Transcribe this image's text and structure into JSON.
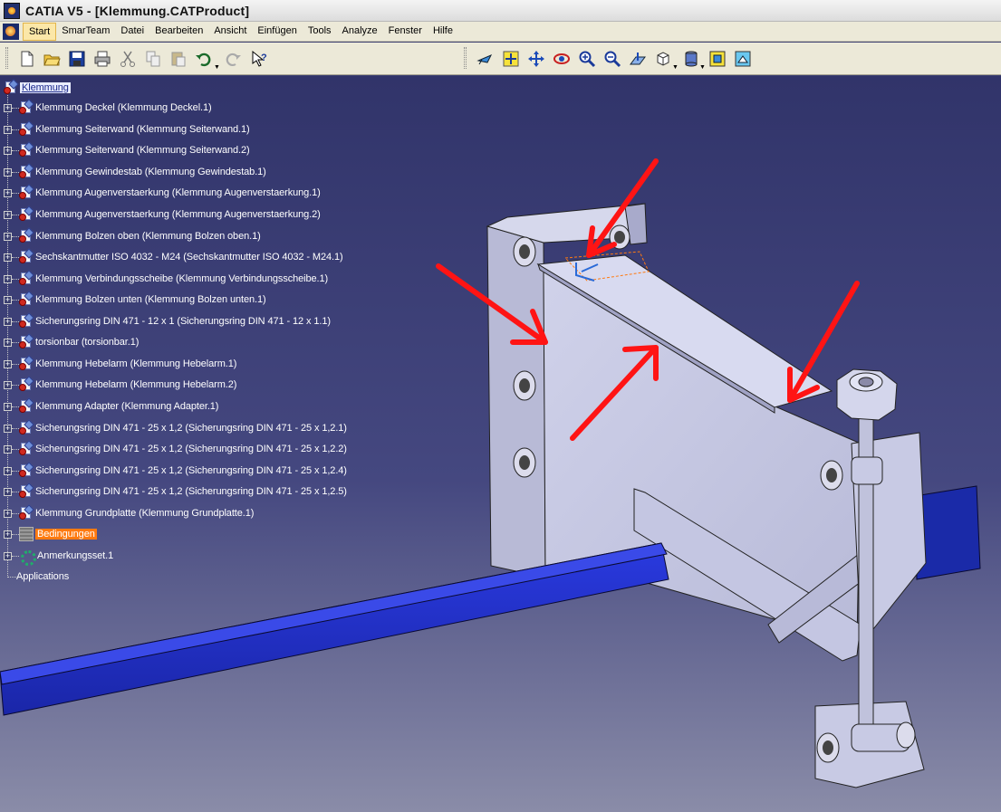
{
  "window": {
    "title": "CATIA V5 - [Klemmung.CATProduct]"
  },
  "menu": {
    "items": [
      "Start",
      "SmarTeam",
      "Datei",
      "Bearbeiten",
      "Ansicht",
      "Einfügen",
      "Tools",
      "Analyze",
      "Fenster",
      "Hilfe"
    ],
    "active": "Start"
  },
  "toolbar": {
    "left": [
      "new-icon",
      "open-icon",
      "save-icon",
      "print-icon",
      "cut-icon",
      "copy-icon",
      "paste-icon",
      "undo-icon",
      "redo-icon",
      "whats-this-icon"
    ],
    "right": [
      "fly-mode-icon",
      "fit-all-icon",
      "pan-icon",
      "rotate-icon",
      "zoom-in-icon",
      "zoom-out-icon",
      "normal-view-icon",
      "iso-view-icon",
      "render-style-icon",
      "hide-show-icon",
      "swap-space-icon"
    ]
  },
  "tree": {
    "root": "Klemmung",
    "nodes": [
      "Klemmung Deckel (Klemmung Deckel.1)",
      "Klemmung Seiterwand (Klemmung Seiterwand.1)",
      "Klemmung Seiterwand (Klemmung Seiterwand.2)",
      "Klemmung Gewindestab (Klemmung Gewindestab.1)",
      "Klemmung Augenverstaerkung (Klemmung Augenverstaerkung.1)",
      "Klemmung Augenverstaerkung (Klemmung Augenverstaerkung.2)",
      "Klemmung Bolzen oben (Klemmung Bolzen oben.1)",
      "Sechskantmutter ISO 4032 - M24 (Sechskantmutter ISO 4032 - M24.1)",
      "Klemmung Verbindungsscheibe (Klemmung Verbindungsscheibe.1)",
      "Klemmung Bolzen unten (Klemmung Bolzen unten.1)",
      "Sicherungsring DIN 471 - 12 x 1 (Sicherungsring DIN 471 - 12 x 1.1)",
      "torsionbar (torsionbar.1)",
      "Klemmung Hebelarm (Klemmung Hebelarm.1)",
      "Klemmung Hebelarm (Klemmung Hebelarm.2)",
      "Klemmung Adapter (Klemmung Adapter.1)",
      "Sicherungsring DIN 471 - 25 x 1,2 (Sicherungsring DIN 471 - 25 x 1,2.1)",
      "Sicherungsring DIN 471 - 25 x 1,2 (Sicherungsring DIN 471 - 25 x 1,2.2)",
      "Sicherungsring DIN 471 - 25 x 1,2 (Sicherungsring DIN 471 - 25 x 1,2.4)",
      "Sicherungsring DIN 471 - 25 x 1,2 (Sicherungsring DIN 471 - 25 x 1,2.5)",
      "Klemmung Grundplatte (Klemmung Grundplatte.1)"
    ],
    "constraints": "Bedingungen",
    "annotations": "Anmerkungsset.1",
    "applications": "Applications"
  },
  "colors": {
    "background_top": "#31346a",
    "background_bottom": "#8a8ca8",
    "beam": "#1a2aa8",
    "plate": "#c6c8e2",
    "arrow": "#ff1414",
    "highlight": "#ff7a10"
  }
}
